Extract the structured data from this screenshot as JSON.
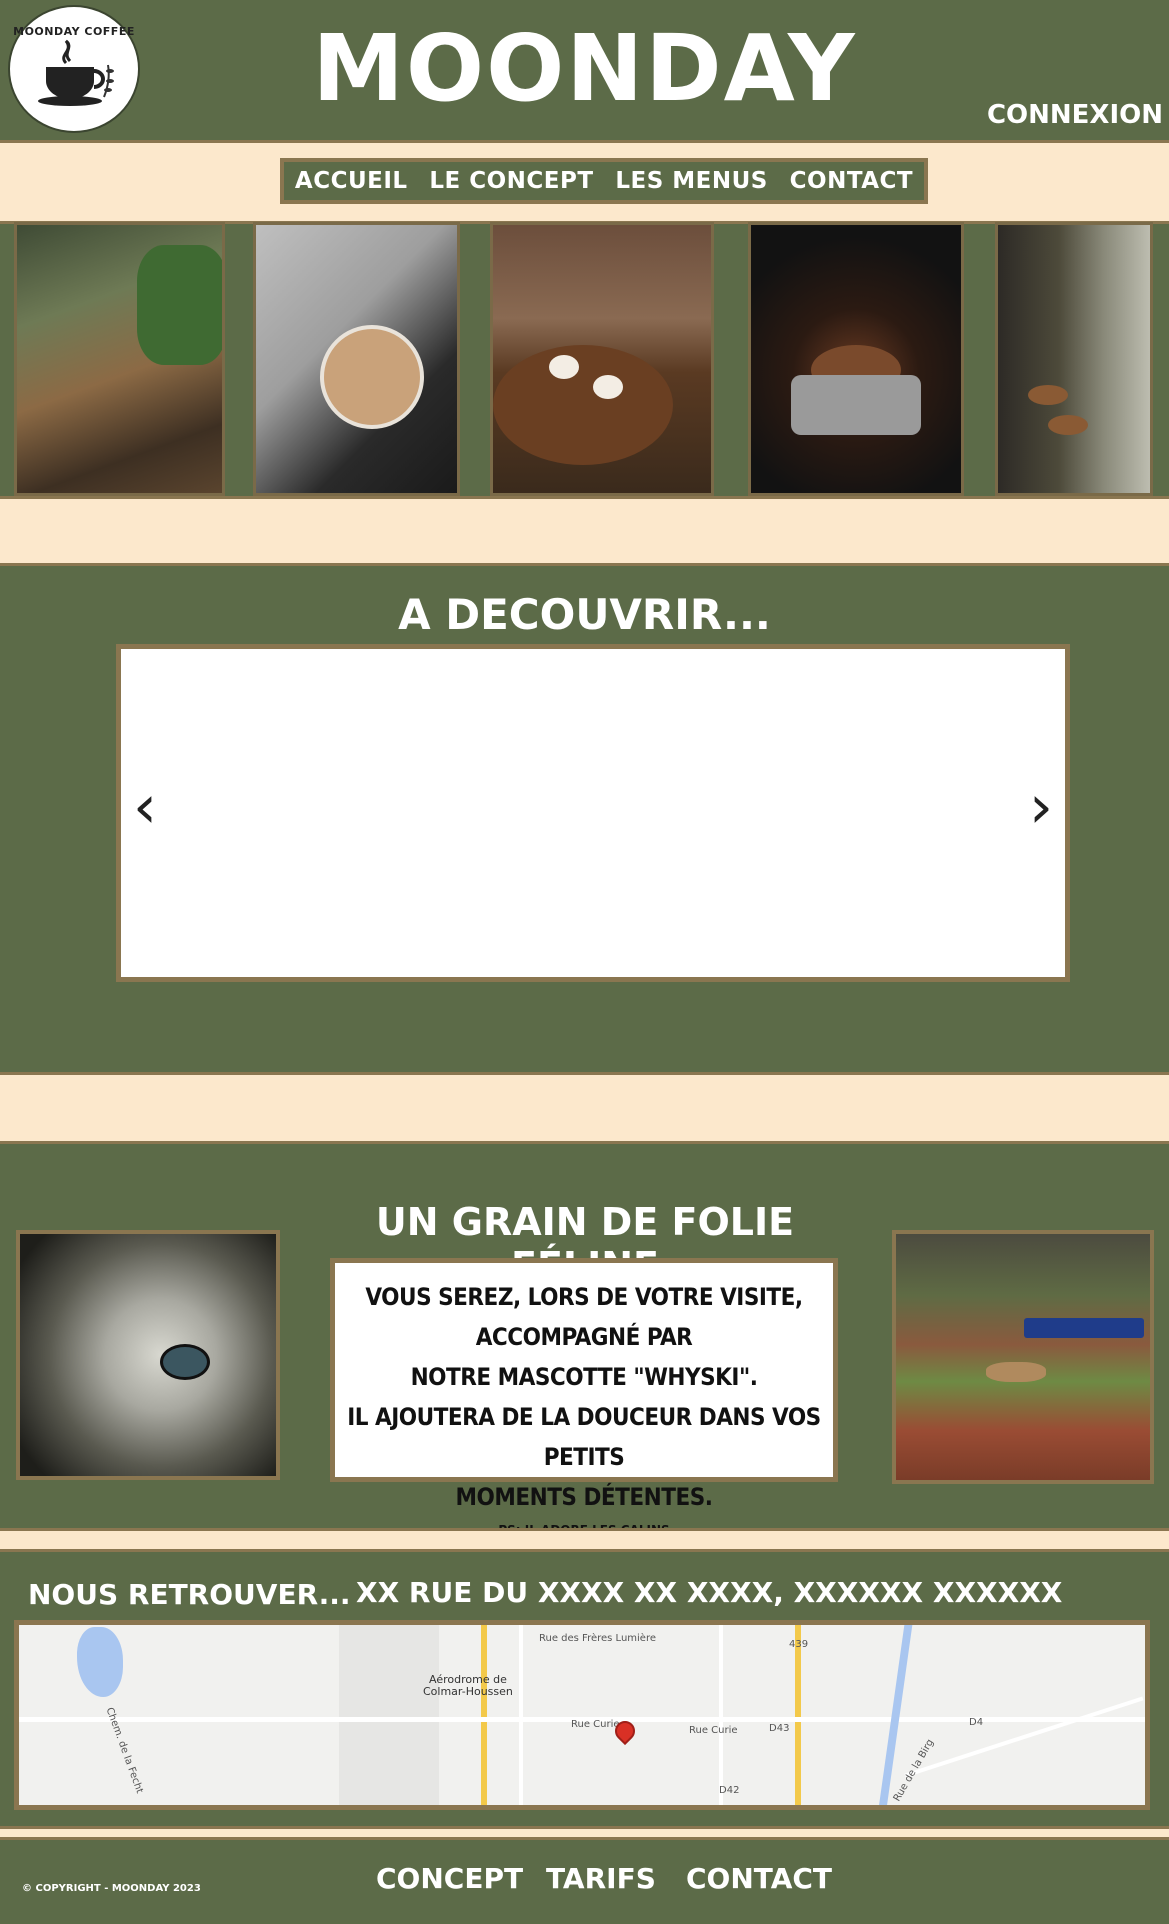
{
  "header": {
    "logo_text": "MOONDAY COFFEE",
    "title": "MOONDAY",
    "login": "CONNEXION"
  },
  "nav": {
    "items": [
      {
        "label": "ACCUEIL"
      },
      {
        "label": "LE CONCEPT"
      },
      {
        "label": "LES MENUS"
      },
      {
        "label": "CONTACT"
      }
    ]
  },
  "discover": {
    "title": "A DECOUVRIR...",
    "prev_icon": "chevron-left-icon",
    "next_icon": "chevron-right-icon"
  },
  "feline": {
    "title": "UN GRAIN DE FOLIE FÉLINE",
    "lines": [
      "VOUS SEREZ, LORS DE VOTRE VISITE, ACCOMPAGNÉ PAR",
      "NOTRE MASCOTTE \"WHYSKI\".",
      "IL AJOUTERA DE LA DOUCEUR DANS VOS PETITS",
      "MOMENTS DÉTENTES."
    ],
    "ps": "PS: IL ADORE LES CALINS"
  },
  "location": {
    "title": "NOUS RETROUVER...",
    "address": "XX RUE DU XXXX XX XXXX, XXXXXX XXXXXX",
    "map_labels": {
      "airfield_1": "Aérodrome de",
      "airfield_2": "Colmar-Houssen",
      "street_1": "Rue des Frères Lumière",
      "street_2": "Rue Curie",
      "street_3": "Rue Curie",
      "road_d4": "D4",
      "road_d43": "D43",
      "road_d42": "D42",
      "street_4": "Rue de la Birg",
      "street_5": "Chem. de la Fecht",
      "road_439": "439"
    }
  },
  "footer": {
    "copyright": "© COPYRIGHT - MOONDAY 2023",
    "links": [
      {
        "label": "CONCEPT"
      },
      {
        "label": "TARIFS"
      },
      {
        "label": "CONTACT"
      }
    ]
  },
  "colors": {
    "background": "#5c6b48",
    "cream": "#fce8cc",
    "border": "#8a7650"
  }
}
